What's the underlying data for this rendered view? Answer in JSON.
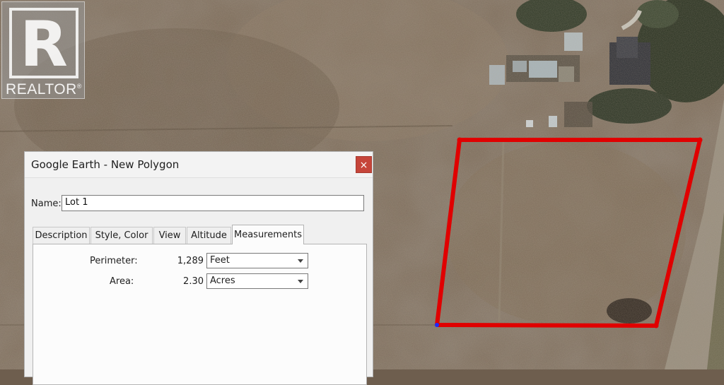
{
  "watermark": {
    "logo_letter": "R",
    "logo_text": "REALTOR",
    "logo_mark": "®"
  },
  "dialog": {
    "title": "Google Earth - New Polygon",
    "close_label": "×",
    "name_label": "Name:",
    "name_value": "Lot 1",
    "tabs": [
      {
        "label": "Description"
      },
      {
        "label": "Style, Color"
      },
      {
        "label": "View"
      },
      {
        "label": "Altitude"
      },
      {
        "label": "Measurements"
      }
    ],
    "active_tab": "Measurements",
    "measurements": {
      "perimeter_label": "Perimeter:",
      "perimeter_value": "1,289",
      "perimeter_unit": "Feet",
      "area_label": "Area:",
      "area_value": "2.30",
      "area_unit": "Acres"
    }
  },
  "map": {
    "polygon_color": "#e00000",
    "vertex_color": "#1a2cff"
  },
  "colors": {
    "close_button": "#c6453a",
    "dialog_bg": "#f0f0f0"
  }
}
